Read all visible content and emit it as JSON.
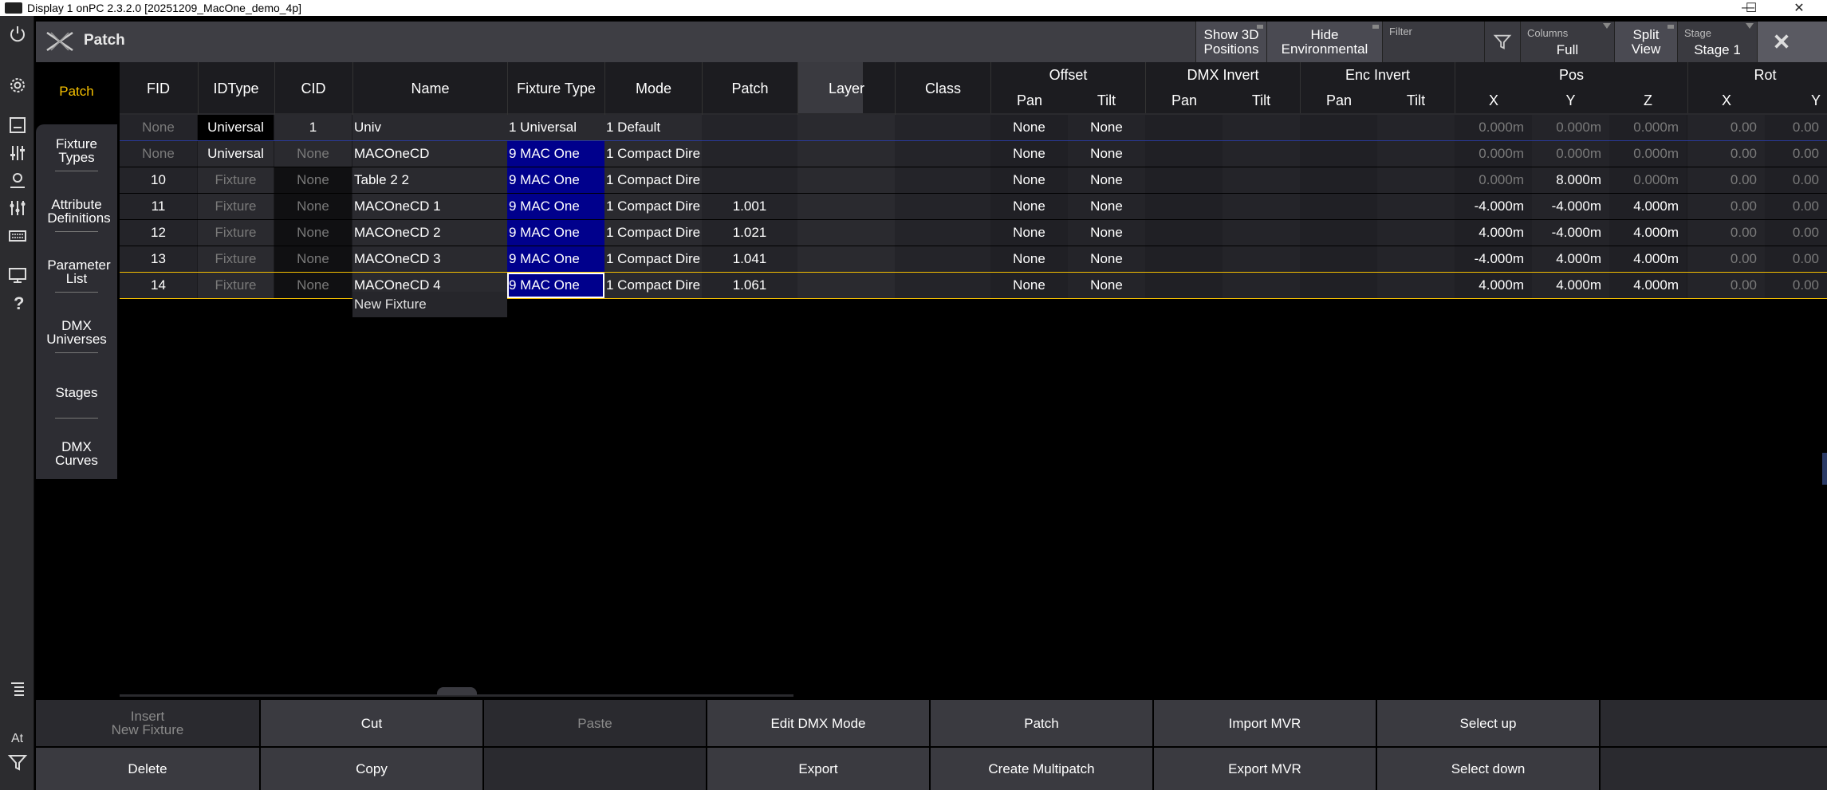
{
  "window": {
    "title": "Display 1 onPC 2.3.2.0 [20251209_MacOne_demo_4p]",
    "min": "—",
    "max": "☐",
    "close": "✕"
  },
  "leftbar": {
    "at_label": "At"
  },
  "header": {
    "title": "Patch",
    "show3d": {
      "l1": "Show 3D",
      "l2": "Positions"
    },
    "hideenv": {
      "l1": "Hide",
      "l2": "Environmental"
    },
    "filter": {
      "label": "Filter"
    },
    "columns": {
      "label": "Columns",
      "value": "Full"
    },
    "split": {
      "l1": "Split",
      "l2": "View"
    },
    "stage": {
      "label": "Stage",
      "value": "Stage 1"
    }
  },
  "sidetabs": {
    "patch": "Patch",
    "fixture_types": {
      "l1": "Fixture",
      "l2": "Types"
    },
    "attribute_definitions": {
      "l1": "Attribute",
      "l2": "Definitions"
    },
    "parameter_list": {
      "l1": "Parameter",
      "l2": "List"
    },
    "dmx_universes": {
      "l1": "DMX",
      "l2": "Universes"
    },
    "stages": "Stages",
    "dmx_curves": {
      "l1": "DMX",
      "l2": "Curves"
    }
  },
  "table": {
    "headers": {
      "fid": "FID",
      "idtype": "IDType",
      "cid": "CID",
      "name": "Name",
      "fixture_type": "Fixture Type",
      "mode": "Mode",
      "patch": "Patch",
      "layer": "Layer",
      "class": "Class",
      "offset": "Offset",
      "offset_pan": "Pan",
      "offset_tilt": "Tilt",
      "dmx_invert": "DMX Invert",
      "dmx_invert_pan": "Pan",
      "dmx_invert_tilt": "Tilt",
      "enc_invert": "Enc Invert",
      "enc_invert_pan": "Pan",
      "enc_invert_tilt": "Tilt",
      "pos": "Pos",
      "pos_x": "X",
      "pos_y": "Y",
      "pos_z": "Z",
      "rot": "Rot",
      "rot_x": "X",
      "rot_y": "Y"
    },
    "rows": [
      {
        "fid": "None",
        "idtype": "Universal",
        "cid": "1",
        "name": "Univ",
        "fixture_type": "1 Universal",
        "mode": "1 Default",
        "patch": "",
        "offset_pan": "None",
        "offset_tilt": "None",
        "pos_x": "0.000m",
        "pos_y": "0.000m",
        "pos_z": "0.000m",
        "rot_x": "0.00",
        "rot_y": "0.00"
      },
      {
        "fid": "None",
        "idtype": "Universal",
        "cid": "None",
        "name": "MACOneCD",
        "fixture_type": "9 MAC One",
        "mode": "1 Compact Dire",
        "patch": "",
        "offset_pan": "None",
        "offset_tilt": "None",
        "pos_x": "0.000m",
        "pos_y": "0.000m",
        "pos_z": "0.000m",
        "rot_x": "0.00",
        "rot_y": "0.00"
      },
      {
        "fid": "10",
        "idtype": "Fixture",
        "cid": "None",
        "name": "Table 2 2",
        "fixture_type": "9 MAC One",
        "mode": "1 Compact Dire",
        "patch": "",
        "offset_pan": "None",
        "offset_tilt": "None",
        "pos_x": "0.000m",
        "pos_y": "8.000m",
        "pos_z": "0.000m",
        "rot_x": "0.00",
        "rot_y": "0.00"
      },
      {
        "fid": "11",
        "idtype": "Fixture",
        "cid": "None",
        "name": "MACOneCD 1",
        "fixture_type": "9 MAC One",
        "mode": "1 Compact Dire",
        "patch": "1.001",
        "offset_pan": "None",
        "offset_tilt": "None",
        "pos_x": "-4.000m",
        "pos_y": "-4.000m",
        "pos_z": "4.000m",
        "rot_x": "0.00",
        "rot_y": "0.00"
      },
      {
        "fid": "12",
        "idtype": "Fixture",
        "cid": "None",
        "name": "MACOneCD 2",
        "fixture_type": "9 MAC One",
        "mode": "1 Compact Dire",
        "patch": "1.021",
        "offset_pan": "None",
        "offset_tilt": "None",
        "pos_x": "4.000m",
        "pos_y": "-4.000m",
        "pos_z": "4.000m",
        "rot_x": "0.00",
        "rot_y": "0.00"
      },
      {
        "fid": "13",
        "idtype": "Fixture",
        "cid": "None",
        "name": "MACOneCD 3",
        "fixture_type": "9 MAC One",
        "mode": "1 Compact Dire",
        "patch": "1.041",
        "offset_pan": "None",
        "offset_tilt": "None",
        "pos_x": "-4.000m",
        "pos_y": "4.000m",
        "pos_z": "4.000m",
        "rot_x": "0.00",
        "rot_y": "0.00"
      },
      {
        "fid": "14",
        "idtype": "Fixture",
        "cid": "None",
        "name": "MACOneCD 4",
        "fixture_type": "9 MAC One",
        "mode": "1 Compact Dire",
        "patch": "1.061",
        "offset_pan": "None",
        "offset_tilt": "None",
        "pos_x": "4.000m",
        "pos_y": "4.000m",
        "pos_z": "4.000m",
        "rot_x": "0.00",
        "rot_y": "0.00"
      }
    ],
    "new_fixture": "New Fixture"
  },
  "bottom": {
    "insert": {
      "l1": "Insert",
      "l2": "New Fixture"
    },
    "cut": "Cut",
    "paste": "Paste",
    "edit_dmx_mode": "Edit DMX Mode",
    "patch": "Patch",
    "import_mvr": "Import MVR",
    "select_up": "Select up",
    "delete": "Delete",
    "copy": "Copy",
    "export": "Export",
    "create_multipatch": "Create Multipatch",
    "export_mvr": "Export MVR",
    "select_down": "Select down"
  },
  "colors": {
    "accent": "#f5c000",
    "selected_blue": "#00008c",
    "header_bg": "#3e3e44"
  }
}
